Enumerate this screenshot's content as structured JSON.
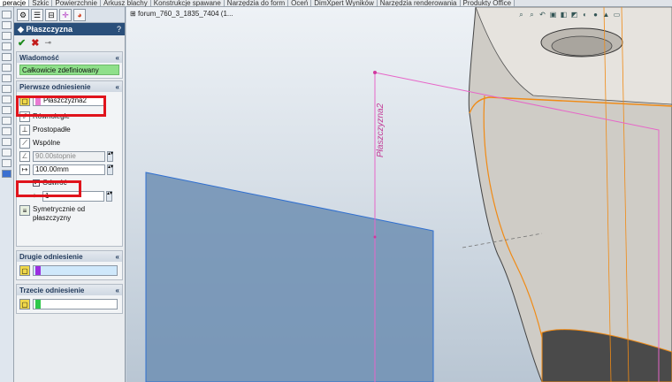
{
  "tabs": [
    "peracje",
    "Szkic",
    "Powierzchnie",
    "Arkusz blachy",
    "Konstrukcje spawane",
    "Narzędzia do form",
    "Oceń",
    "DimXpert Wyników",
    "Narzędzia renderowania",
    "Produkty Office"
  ],
  "active_tab_index": 0,
  "property_manager": {
    "title": "Płaszczyzna",
    "help_label": "?",
    "message_section": {
      "title": "Wiadomość",
      "text": "Całkowicie zdefiniowany"
    },
    "first_reference": {
      "title": "Pierwsze odniesienie",
      "selection": "Płaszczyzna2",
      "selection_color": "#e87ad2",
      "options": [
        "Równoległe",
        "Prostopadłe",
        "Wspólne"
      ],
      "angle_value": "90.00stopnie",
      "distance_value": "100.00mm",
      "flip_label": "Odwróć",
      "flip_checked": true,
      "instances_value": "1",
      "mid_plane_label": "Symetrycznie od płaszczyzny"
    },
    "second_reference": {
      "title": "Drugie odniesienie",
      "selection_color": "#9b2fe0"
    },
    "third_reference": {
      "title": "Trzecie odniesienie",
      "selection_color": "#2ec84a"
    }
  },
  "viewport": {
    "feature_tree_title": "forum_760_3_1835_7404  (1...",
    "plane_label": "Płaszczyzna2",
    "highlight_color": "#e0141c"
  }
}
